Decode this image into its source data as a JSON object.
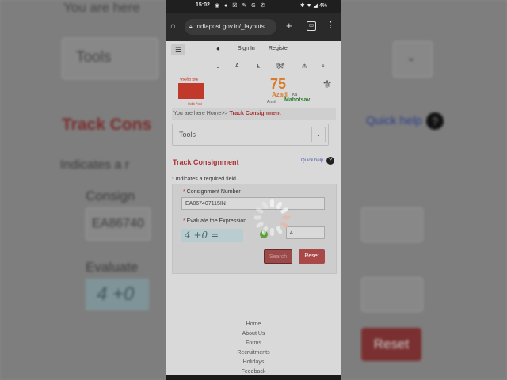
{
  "status_bar": {
    "time": "15:02",
    "battery": "4%"
  },
  "browser": {
    "url": "indiapost.gov.in/_layouts",
    "tab_count": "83"
  },
  "header": {
    "sign_in": "Sign In",
    "register": "Register",
    "hindi": "हिंदी"
  },
  "logos": {
    "india_post_hindi": "भारतीय डाक",
    "india_post_en": "India Post",
    "azadi_number": "75",
    "azadi_word": "Azadi",
    "amrit_word": "Amrit",
    "ka_word": "Ka",
    "mahotsav_word": "Mahotsav"
  },
  "breadcrumb": {
    "prefix": "You are here Home>> ",
    "current": "Track Consignment"
  },
  "tools": {
    "label": "Tools"
  },
  "form": {
    "title": "Track Consignment",
    "quick_help": "Quick help",
    "required_note": "Indicates a required field.",
    "consignment_label": "Consignment Number",
    "consignment_value": "EA867407115IN",
    "expression_label": "Evaluate the Expression",
    "captcha_text": "4 +0 =",
    "answer_value": "4",
    "search_label": "Search",
    "reset_label": "Reset"
  },
  "footer": {
    "links": [
      "Home",
      "About Us",
      "Forms",
      "Recruitments",
      "Holidays",
      "Feedback"
    ]
  },
  "background": {
    "you_are_here": "You are here",
    "tools": "Tools",
    "track": "Track Cons",
    "indicates": "Indicates a r",
    "consign": "Consign",
    "consign_value": "EA86740",
    "evaluate": "Evaluate",
    "captcha": "4 +0",
    "quick_help": "Quick help",
    "reset": "Reset"
  }
}
